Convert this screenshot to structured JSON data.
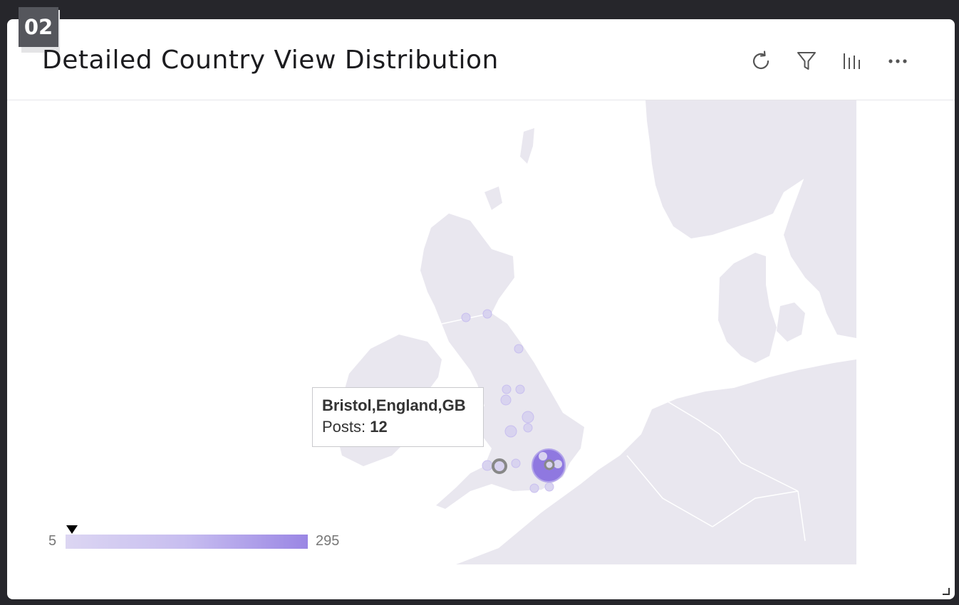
{
  "panel": {
    "badge": "02",
    "title": "Detailed Country View Distribution"
  },
  "toolbar": {
    "refresh_icon": "refresh-icon",
    "filter_icon": "filter-icon",
    "chart_icon": "bar-chart-icon",
    "more_icon": "more-icon"
  },
  "tooltip": {
    "place": "Bristol,England,GB",
    "metric_label": "Posts: ",
    "metric_value": "12"
  },
  "legend": {
    "min": "5",
    "max": "295"
  },
  "colors": {
    "land": "#e9e7ef",
    "bubble_light": "#d8d2f0",
    "bubble_strong": "#8f78e0",
    "highlight_ring": "#888888"
  }
}
